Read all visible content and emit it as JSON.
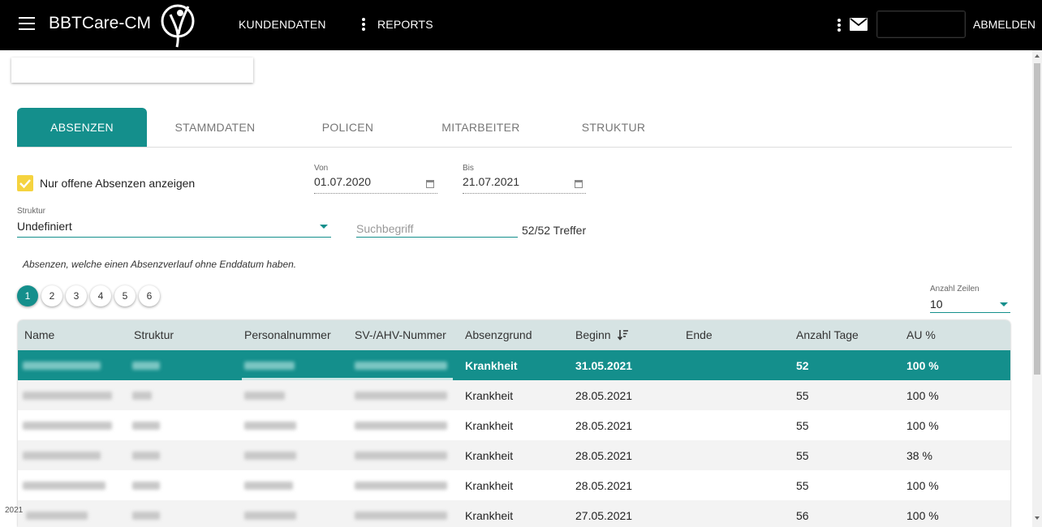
{
  "header": {
    "brand": "BBTCare-CM",
    "nav_kundendaten": "KUNDENDATEN",
    "nav_reports": "REPORTS",
    "logout": "ABMELDEN"
  },
  "tabs": [
    {
      "label": "ABSENZEN",
      "active": true
    },
    {
      "label": "STAMMDATEN",
      "active": false
    },
    {
      "label": "POLICEN",
      "active": false
    },
    {
      "label": "MITARBEITER",
      "active": false
    },
    {
      "label": "STRUKTUR",
      "active": false
    }
  ],
  "filters": {
    "open_only_label": "Nur offene Absenzen anzeigen",
    "open_only_checked": true,
    "von_label": "Von",
    "von_value": "01.07.2020",
    "bis_label": "Bis",
    "bis_value": "21.07.2021",
    "struktur_label": "Struktur",
    "struktur_value": "Undefiniert",
    "search_placeholder": "Suchbegriff",
    "hits": "52/52 Treffer"
  },
  "note": "Absenzen, welche einen Absenzverlauf ohne Enddatum haben.",
  "pagination": {
    "pages": [
      "1",
      "2",
      "3",
      "4",
      "5",
      "6"
    ],
    "active_page": "1",
    "rows_label": "Anzahl Zeilen",
    "rows_value": "10"
  },
  "table": {
    "columns": [
      "Name",
      "Struktur",
      "Personalnummer",
      "SV-/AHV-Nummer",
      "Absenzgrund",
      "Beginn",
      "Ende",
      "Anzahl Tage",
      "AU %"
    ],
    "rows": [
      {
        "grund": "Krankheit",
        "beginn": "31.05.2021",
        "ende": "",
        "tage": "52",
        "au": "100 %",
        "selected": true
      },
      {
        "grund": "Krankheit",
        "beginn": "28.05.2021",
        "ende": "",
        "tage": "55",
        "au": "100 %",
        "selected": false
      },
      {
        "grund": "Krankheit",
        "beginn": "28.05.2021",
        "ende": "",
        "tage": "55",
        "au": "100 %",
        "selected": false
      },
      {
        "grund": "Krankheit",
        "beginn": "28.05.2021",
        "ende": "",
        "tage": "55",
        "au": "38 %",
        "selected": false
      },
      {
        "grund": "Krankheit",
        "beginn": "28.05.2021",
        "ende": "",
        "tage": "55",
        "au": "100 %",
        "selected": false
      },
      {
        "grund": "Krankheit",
        "beginn": "27.05.2021",
        "ende": "",
        "tage": "56",
        "au": "100 %",
        "selected": false
      }
    ]
  },
  "footer": {
    "year": "2021"
  },
  "colors": {
    "accent": "#148f8c",
    "checkbox": "#f5d33f",
    "topbar": "#000000",
    "table_header": "#d6e3e3"
  },
  "icons": [
    "menu-icon",
    "logo-icon",
    "more-vert-icon",
    "mail-icon",
    "calendar-icon",
    "dropdown-arrow-icon",
    "sort-desc-icon",
    "check-icon"
  ]
}
